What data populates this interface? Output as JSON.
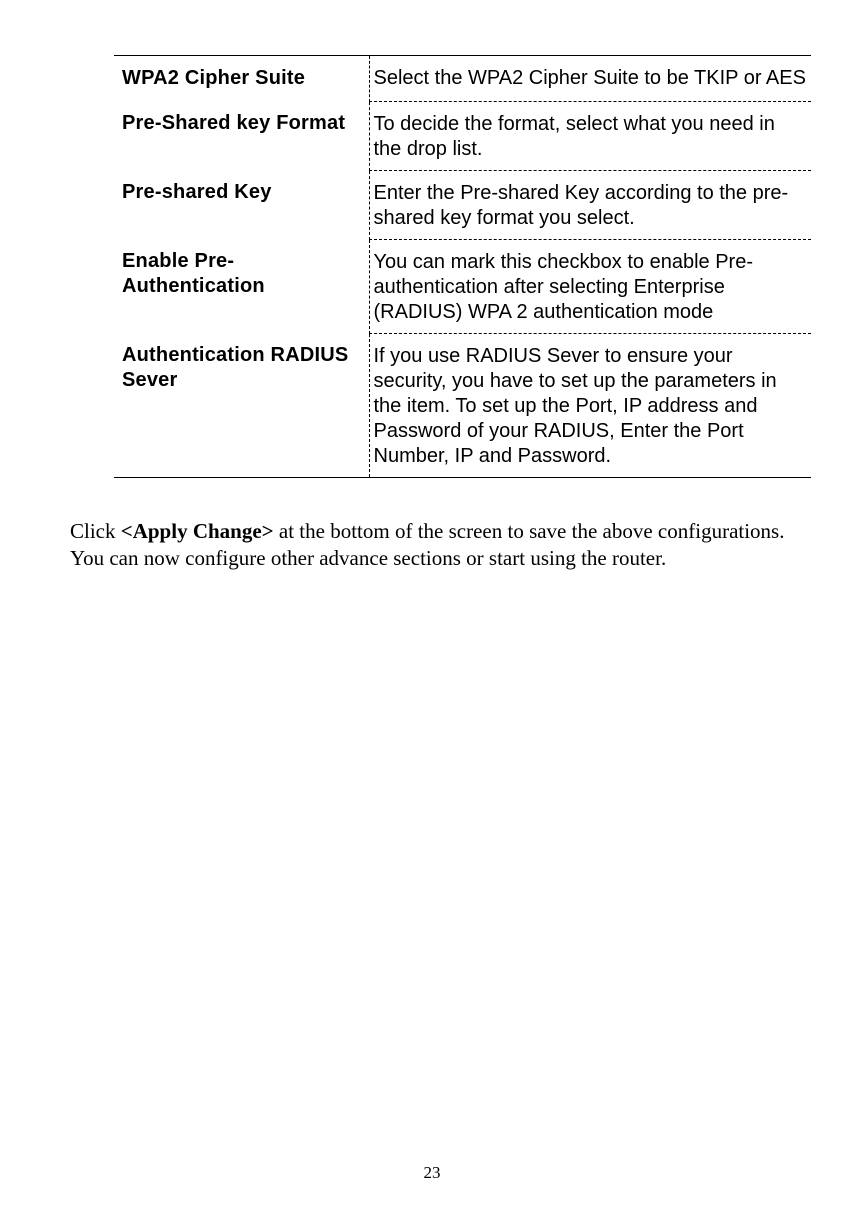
{
  "table": {
    "rows": [
      {
        "label": "WPA2  Cipher  Suite",
        "desc": "Select the WPA2 Cipher Suite to be TKIP or AES"
      },
      {
        "label": "Pre-Shared key Format",
        "desc": "To decide the format, select what you need in the drop list."
      },
      {
        "label": "Pre-shared  Key",
        "desc": "Enter the Pre-shared Key according to the pre-shared key format you select."
      },
      {
        "label": "Enable  Pre-Authentication",
        "desc": "You can mark this checkbox to enable Pre-authentication after selecting Enterprise (RADIUS) WPA 2 authentication mode"
      },
      {
        "label": "Authentication  RADIUS Sever",
        "desc": "If you use RADIUS Sever to ensure your security, you have to set up the parameters in the item. To set up the Port, IP address and Password of your RADIUS, Enter the Port Number, IP and Password."
      }
    ]
  },
  "instruction": {
    "prefix": "Click ",
    "bold": "<Apply Change>",
    "suffix": " at the bottom of the screen to save the above configurations. You can now configure other advance sections or start using the router."
  },
  "page_number": "23"
}
